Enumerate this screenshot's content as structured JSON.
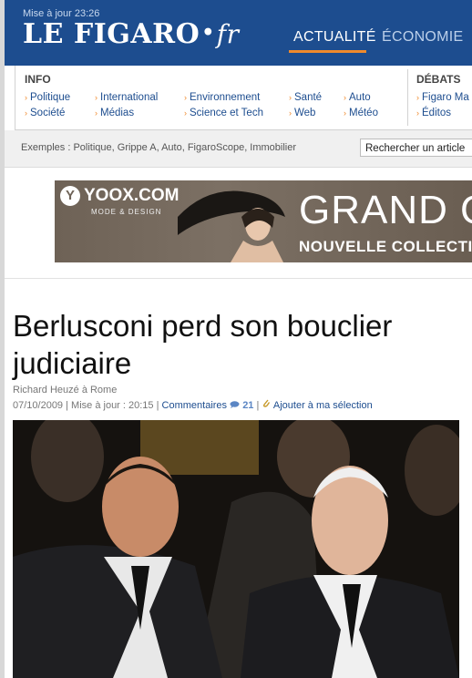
{
  "header": {
    "update_label": "Mise à jour 23:26",
    "logo": {
      "main": "LE FIGARO",
      "dot": "•",
      "suffix": "fr"
    },
    "nav_tabs": [
      {
        "label": "ACTUALITÉ",
        "active": true
      },
      {
        "label": "ÉCONOMIE",
        "active": false
      }
    ]
  },
  "topics": {
    "info_label": "INFO",
    "debats_label": "DÉBATS",
    "items": [
      "Politique",
      "International",
      "Environnement",
      "Santé",
      "Auto",
      "Société",
      "Médias",
      "Science et Tech",
      "Web",
      "Météo"
    ],
    "debats_items": [
      "Figaro Ma",
      "Éditos"
    ],
    "arrow_icon": "›"
  },
  "search": {
    "examples": "Exemples : Politique, Grippe A, Auto, FigaroScope, Immobilier",
    "placeholder": "Rechercher un article"
  },
  "ad": {
    "brand": "YOOX.COM",
    "brand_letter": "Y",
    "brand_sub": "MODE & DESIGN",
    "headline": "GRAND OPI",
    "subline": "NOUVELLE COLLECTION AUT"
  },
  "article": {
    "title": "Berlusconi perd son bouclier judiciaire",
    "author": "Richard Heuzé à Rome",
    "date": "07/10/2009",
    "sep1": " | ",
    "update": "Mise à jour : 20:15",
    "sep2": " | ",
    "comments_label": "Commentaires",
    "comments_count": "21",
    "sep3": " | ",
    "add_selection": "Ajouter à ma sélection"
  },
  "colors": {
    "brand_blue": "#1d4d8f",
    "accent_orange": "#f08a2c"
  }
}
